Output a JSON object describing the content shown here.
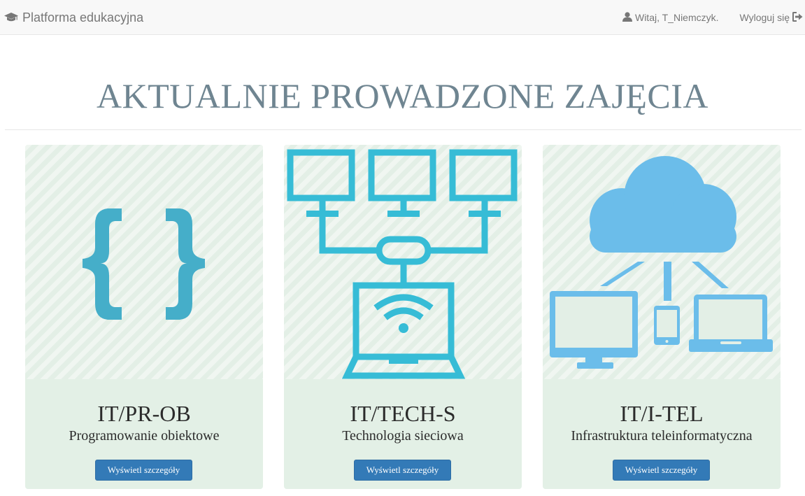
{
  "navbar": {
    "brand_icon": "graduation-cap-icon",
    "brand_label": "Platforma edukacyjna",
    "user_icon": "user-icon",
    "greeting": "Witaj, T_Niemczyk.",
    "logout_label": "Wyloguj się",
    "logout_icon": "sign-out-icon"
  },
  "page": {
    "title": "AKTUALNIE PROWADZONE ZAJĘCIA"
  },
  "colors": {
    "card_background": "#e3f0e6",
    "button": "#337ab7",
    "title": "#6f8591",
    "braces": "#45aec9",
    "network": "#36bcd6",
    "cloud": "#6bbdea"
  },
  "courses": [
    {
      "code": "IT/PR-OB",
      "name": "Programowanie obiektowe",
      "icon": "curly-braces-icon",
      "button_label": "Wyświetl szczegóły"
    },
    {
      "code": "IT/TECH-S",
      "name": "Technologia sieciowa",
      "icon": "network-computers-icon",
      "button_label": "Wyświetl szczegóły"
    },
    {
      "code": "IT/I-TEL",
      "name": "Infrastruktura teleinformatyczna",
      "icon": "cloud-devices-icon",
      "button_label": "Wyświetl szczegóły"
    }
  ]
}
